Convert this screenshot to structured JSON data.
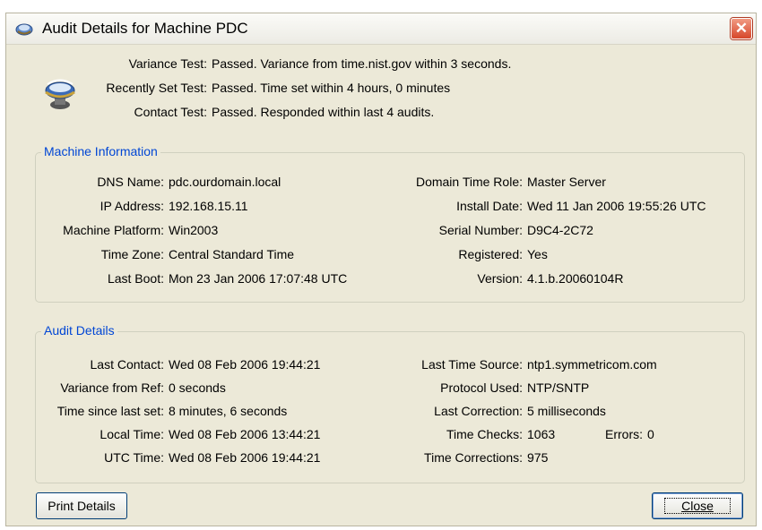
{
  "window": {
    "title": "Audit Details for Machine PDC",
    "close_glyph": "✕",
    "icons": {
      "app": "globe-clock-icon",
      "status": "time-server-icon"
    }
  },
  "tests": [
    {
      "label": "Variance Test:",
      "value": "Passed. Variance from time.nist.gov within 3 seconds."
    },
    {
      "label": "Recently Set Test:",
      "value": "Passed. Time set within 4 hours, 0 minutes"
    },
    {
      "label": "Contact Test:",
      "value": "Passed. Responded within last 4 audits."
    }
  ],
  "machine_info": {
    "legend": "Machine Information",
    "left": [
      {
        "label": "DNS Name:",
        "value": "pdc.ourdomain.local"
      },
      {
        "label": "IP Address:",
        "value": "192.168.15.11"
      },
      {
        "label": "Machine Platform:",
        "value": "Win2003"
      },
      {
        "label": "Time Zone:",
        "value": "Central Standard Time"
      },
      {
        "label": "Last Boot:",
        "value": "Mon 23 Jan 2006 17:07:48 UTC"
      }
    ],
    "right": [
      {
        "label": "Domain Time Role:",
        "value": "Master Server"
      },
      {
        "label": "Install Date:",
        "value": "Wed 11 Jan 2006 19:55:26 UTC"
      },
      {
        "label": "Serial Number:",
        "value": "D9C4-2C72"
      },
      {
        "label": "Registered:",
        "value": "Yes"
      },
      {
        "label": "Version:",
        "value": "4.1.b.20060104R"
      }
    ]
  },
  "audit_details": {
    "legend": "Audit Details",
    "left": [
      {
        "label": "Last Contact:",
        "value": "Wed 08 Feb 2006 19:44:21"
      },
      {
        "label": "Variance from Ref:",
        "value": "0 seconds"
      },
      {
        "label": "Time since last set:",
        "value": "8 minutes, 6 seconds"
      },
      {
        "label": "Local Time:",
        "value": "Wed 08 Feb 2006 13:44:21"
      },
      {
        "label": "UTC Time:",
        "value": "Wed 08 Feb 2006 19:44:21"
      }
    ],
    "right": [
      {
        "label": "Last Time Source:",
        "value": "ntp1.symmetricom.com"
      },
      {
        "label": "Protocol Used:",
        "value": "NTP/SNTP"
      },
      {
        "label": "Last Correction:",
        "value": "5 milliseconds"
      },
      {
        "label": "Time Checks:",
        "value": "1063"
      },
      {
        "label": "Time Corrections:",
        "value": "975"
      }
    ],
    "errors": {
      "label": "Errors:",
      "value": "0"
    }
  },
  "buttons": {
    "print": "Print Details",
    "close": "Close"
  },
  "colors": {
    "accent": "#0046d5",
    "window_bg": "#ece9d8",
    "close_red": "#d6472b"
  }
}
